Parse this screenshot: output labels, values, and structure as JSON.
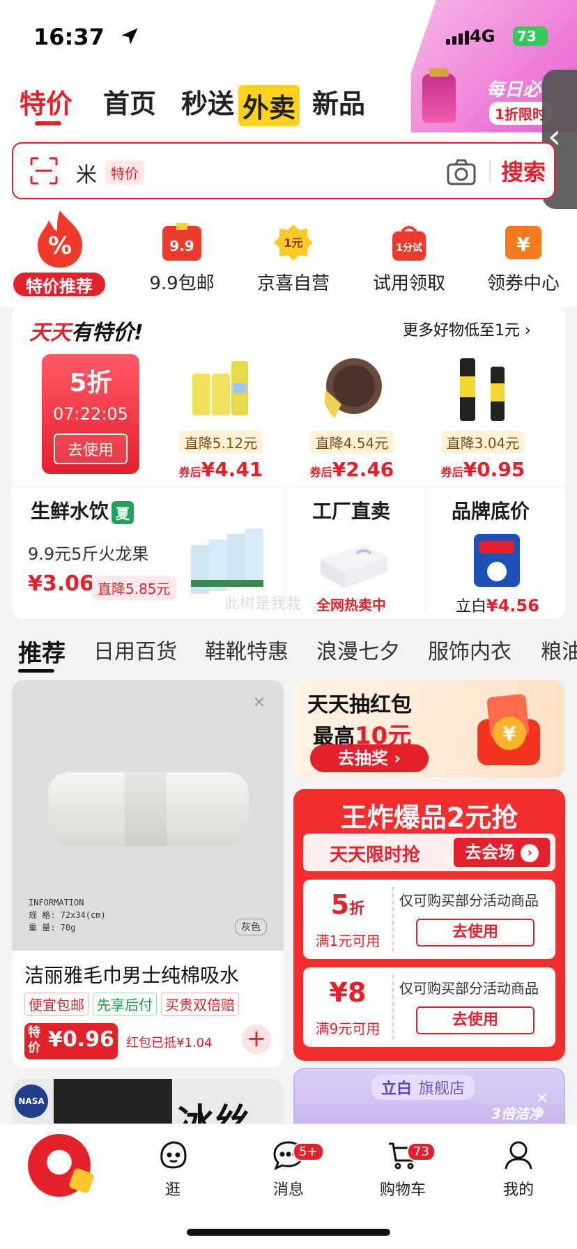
{
  "status_bar": {
    "time": "16:37",
    "network": "4G",
    "battery": "73"
  },
  "top_nav": {
    "tabs": [
      "特价",
      "首页",
      "秒送",
      "新品"
    ],
    "takeout_badge": "外卖",
    "active_index": 0
  },
  "promo": {
    "line1": "每日必",
    "line2": "1折限时"
  },
  "search": {
    "query": "米",
    "tag": "特价",
    "button": "搜索"
  },
  "categories": [
    {
      "label": "特价推荐",
      "icon": "percent-flame-icon"
    },
    {
      "label": "9.9包邮",
      "icon": "price-9-9-icon"
    },
    {
      "label": "京喜自营",
      "icon": "one-yuan-icon"
    },
    {
      "label": "试用领取",
      "icon": "trial-bag-icon"
    },
    {
      "label": "领券中心",
      "icon": "yen-coupon-icon"
    }
  ],
  "daily": {
    "title_a": "天天",
    "title_b": "有特价!",
    "more": "更多好物低至1元 ›",
    "coupon": {
      "discount": "5折",
      "countdown": "07:22:05",
      "button": "去使用"
    },
    "deals": [
      {
        "drop": "直降5.12元",
        "prefix": "券后",
        "price": "¥4.41"
      },
      {
        "drop": "直降4.54元",
        "prefix": "券后",
        "price": "¥2.46"
      },
      {
        "drop": "直降3.04元",
        "prefix": "券后",
        "price": "¥0.95"
      }
    ]
  },
  "fresh": {
    "title": "生鲜水饮",
    "badge": "夏",
    "subtitle": "9.9元5斤火龙果",
    "price": "¥3.06",
    "drop": "直降5.85元"
  },
  "factory": {
    "title": "工厂直卖",
    "subtitle": "全网热卖中"
  },
  "brand_floor": {
    "title": "品牌底价",
    "name": "立白",
    "price": "¥4.56"
  },
  "watermark": "此树是我栽",
  "feed_tabs": [
    "推荐",
    "日用百货",
    "鞋靴特惠",
    "浪漫七夕",
    "服饰内衣",
    "粮油"
  ],
  "product": {
    "info_heading": "INFORMATION",
    "info_spec": "规  格: 72x34(cm)",
    "info_weight": "重  量: 70g",
    "color": "灰色",
    "name": "洁丽雅毛巾男士纯棉吸水",
    "tags": [
      "便宜包邮",
      "先享后付",
      "买贵双倍赔"
    ],
    "price_tag": "特价",
    "price": "¥0.96",
    "red_packet": "红包已抵¥1.04"
  },
  "redpacket_banner": {
    "line1": "天天抽红包",
    "line2_a": "最高",
    "line2_b": "10元",
    "button": "去抽奖 ›"
  },
  "king_deals": {
    "title": "王炸爆品2元抢",
    "bar_left": "天天限时抢",
    "bar_right": "去会场",
    "vouchers": [
      {
        "value": "5",
        "unit": "折",
        "condition": "满1元可用",
        "desc": "仅可购买部分活动商品",
        "button": "去使用"
      },
      {
        "value": "¥8",
        "unit": "",
        "condition": "满9元可用",
        "desc": "仅可购买部分活动商品",
        "button": "去使用"
      }
    ]
  },
  "bottom_left": {
    "logo": "NASA",
    "text": "冰丝"
  },
  "bottom_right": {
    "brand": "立白",
    "store": "旗舰店",
    "slogan": "3倍洁净"
  },
  "tabbar": [
    {
      "label": "",
      "icon": "home-mascot-icon"
    },
    {
      "label": "逛",
      "icon": "browse-face-icon"
    },
    {
      "label": "消息",
      "icon": "message-icon",
      "badge": "5+"
    },
    {
      "label": "购物车",
      "icon": "cart-icon",
      "badge": "73"
    },
    {
      "label": "我的",
      "icon": "profile-icon"
    }
  ]
}
